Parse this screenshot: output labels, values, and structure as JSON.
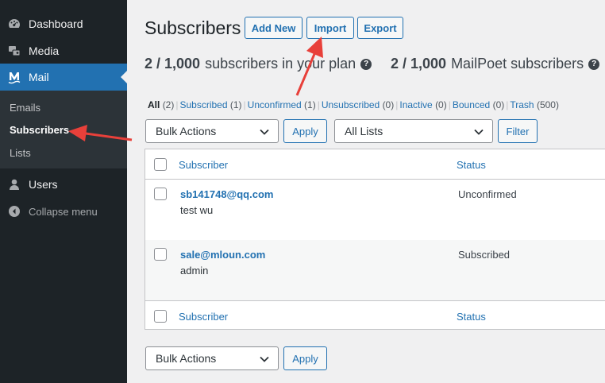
{
  "sidebar": {
    "items": [
      {
        "label": "Dashboard",
        "icon": "dashboard-icon"
      },
      {
        "label": "Media",
        "icon": "media-icon"
      },
      {
        "label": "Mail",
        "icon": "mailpoet-icon"
      },
      {
        "label": "Users",
        "icon": "users-icon"
      }
    ],
    "submenu": [
      "Emails",
      "Subscribers",
      "Lists"
    ],
    "current_submenu": "Subscribers",
    "collapse_label": "Collapse menu"
  },
  "header": {
    "title": "Subscribers",
    "add_new": "Add New",
    "import": "Import",
    "export": "Export"
  },
  "plan": {
    "plan_count": "2 / 1,000",
    "plan_text": "subscribers in your plan",
    "mp_count": "2 / 1,000",
    "mp_text": "MailPoet subscribers",
    "help_glyph": "?"
  },
  "filters": [
    {
      "label": "All",
      "count": "(2)"
    },
    {
      "label": "Subscribed",
      "count": "(1)"
    },
    {
      "label": "Unconfirmed",
      "count": "(1)"
    },
    {
      "label": "Unsubscribed",
      "count": "(0)"
    },
    {
      "label": "Inactive",
      "count": "(0)"
    },
    {
      "label": "Bounced",
      "count": "(0)"
    },
    {
      "label": "Trash",
      "count": "(500)"
    }
  ],
  "toolbar": {
    "bulk_actions": "Bulk Actions",
    "apply": "Apply",
    "all_lists": "All Lists",
    "filter": "Filter"
  },
  "table": {
    "columns": [
      "Subscriber",
      "Status"
    ],
    "rows": [
      {
        "email": "sb141748@qq.com",
        "name": "test wu",
        "status": "Unconfirmed"
      },
      {
        "email": "sale@mloun.com",
        "name": "admin",
        "status": "Subscribed"
      }
    ]
  },
  "colors": {
    "sidebar_bg": "#1d2327",
    "accent": "#2271b1",
    "annotation_arrow": "#e8403a"
  }
}
